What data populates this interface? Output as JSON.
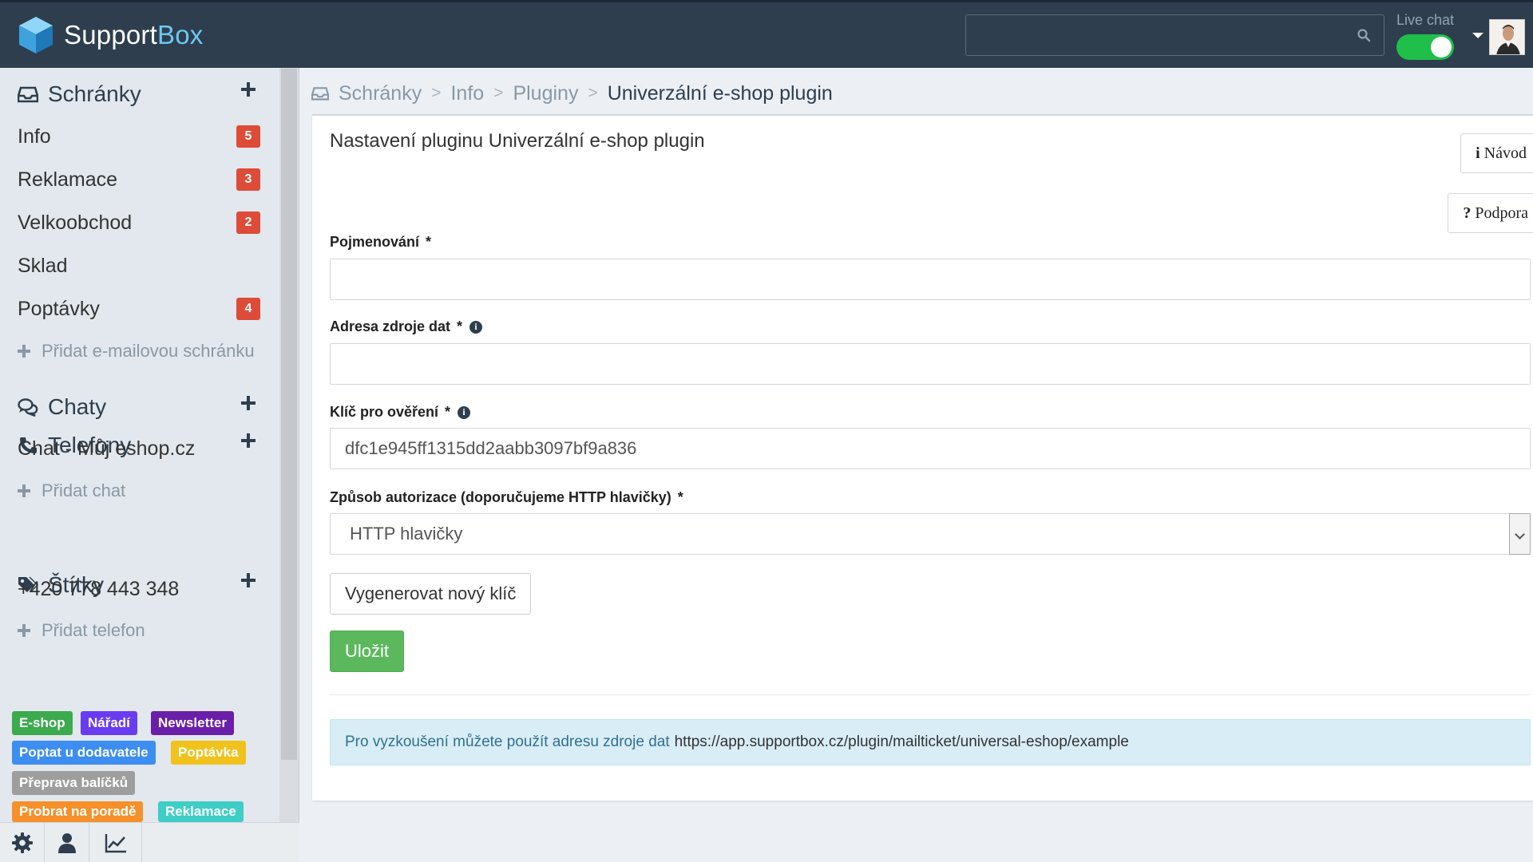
{
  "header": {
    "logo_part1": "Support",
    "logo_part2": "Box",
    "search_placeholder": "",
    "live_chat_label": "Live chat",
    "live_chat_on": true
  },
  "sidebar": {
    "sections": {
      "mailboxes": {
        "title": "Schránky",
        "items": [
          {
            "label": "Info",
            "badge": "5"
          },
          {
            "label": "Reklamace",
            "badge": "3"
          },
          {
            "label": "Velkoobchod",
            "badge": "2"
          },
          {
            "label": "Sklad",
            "badge": ""
          },
          {
            "label": "Poptávky",
            "badge": "4"
          }
        ],
        "add_label": "Přidat e-mailovou schránku"
      },
      "chats": {
        "title": "Chaty",
        "items": [
          {
            "label": "Chat - Můj eshop.cz"
          }
        ],
        "add_label": "Přidat chat"
      },
      "phones": {
        "title": "Telefony",
        "items": [
          {
            "label": "+420 778 443 348"
          }
        ],
        "add_label": "Přidat telefon"
      },
      "tags": {
        "title": "Štítky",
        "items": [
          {
            "label": "E-shop",
            "color": "#3bab4e"
          },
          {
            "label": "Nářadí",
            "color": "#6a3cf0"
          },
          {
            "label": "Newsletter",
            "color": "#6a1fa8"
          },
          {
            "label": "Poptat u dodavatele",
            "color": "#3d8ef0"
          },
          {
            "label": "Poptávka",
            "color": "#f0c21b"
          },
          {
            "label": "Přeprava balíčků",
            "color": "#9e9e9e"
          },
          {
            "label": "Probrat na poradě",
            "color": "#f5902a"
          },
          {
            "label": "Reklamace",
            "color": "#3fcdc7"
          }
        ]
      }
    }
  },
  "breadcrumb": {
    "items": [
      "Schránky",
      "Info",
      "Pluginy"
    ],
    "current": "Univerzální e-shop plugin",
    "separator": ">"
  },
  "panel": {
    "title": "Nastavení pluginu Univerzální e-shop plugin",
    "guide_label": "Návod",
    "guide_glyph": "i",
    "support_label": "Podpora",
    "support_glyph": "?",
    "fields": {
      "name": {
        "label": "Pojmenování",
        "required": "*",
        "value": ""
      },
      "source": {
        "label": "Adresa zdroje dat",
        "required": "*",
        "value": ""
      },
      "key": {
        "label": "Klíč pro ověření",
        "required": "*",
        "value": "dfc1e945ff1315dd2aabb3097bf9a836"
      },
      "auth": {
        "label": "Způsob autorizace (doporučujeme HTTP hlavičky)",
        "required": "*",
        "value": "HTTP hlavičky"
      }
    },
    "generate_label": "Vygenerovat nový klíč",
    "save_label": "Uložit",
    "info_text": "Pro vyzkoušení můžete použít adresu zdroje dat",
    "info_url": "https://app.supportbox.cz/plugin/mailticket/universal-eshop/example"
  },
  "colors": {
    "header_bg": "#2e3e4e",
    "badge": "#dd4b39",
    "save_green": "#5cb85c",
    "toggle_green": "#1fbf4a",
    "logo_blue": "#6ec8f2"
  }
}
